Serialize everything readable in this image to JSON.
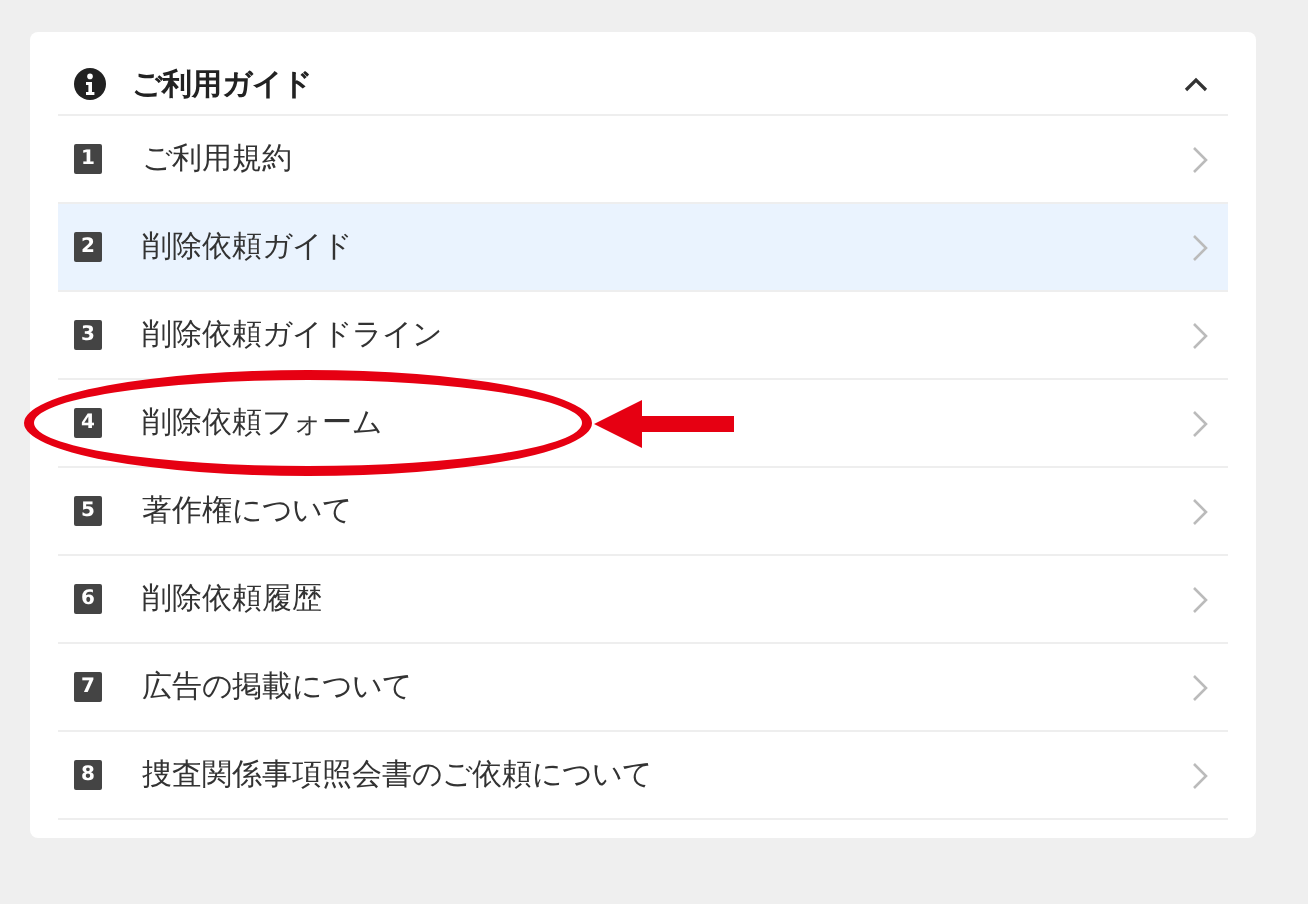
{
  "panel": {
    "title": "ご利用ガイド",
    "expanded": true
  },
  "items": [
    {
      "number": "1",
      "label": "ご利用規約",
      "selected": false,
      "circled": false
    },
    {
      "number": "2",
      "label": "削除依頼ガイド",
      "selected": true,
      "circled": false
    },
    {
      "number": "3",
      "label": "削除依頼ガイドライン",
      "selected": false,
      "circled": false
    },
    {
      "number": "4",
      "label": "削除依頼フォーム",
      "selected": false,
      "circled": true
    },
    {
      "number": "5",
      "label": "著作権について",
      "selected": false,
      "circled": false
    },
    {
      "number": "6",
      "label": "削除依頼履歴",
      "selected": false,
      "circled": false
    },
    {
      "number": "7",
      "label": "広告の掲載について",
      "selected": false,
      "circled": false
    },
    {
      "number": "8",
      "label": "捜査関係事項照会書のご依頼について",
      "selected": false,
      "circled": false
    }
  ]
}
